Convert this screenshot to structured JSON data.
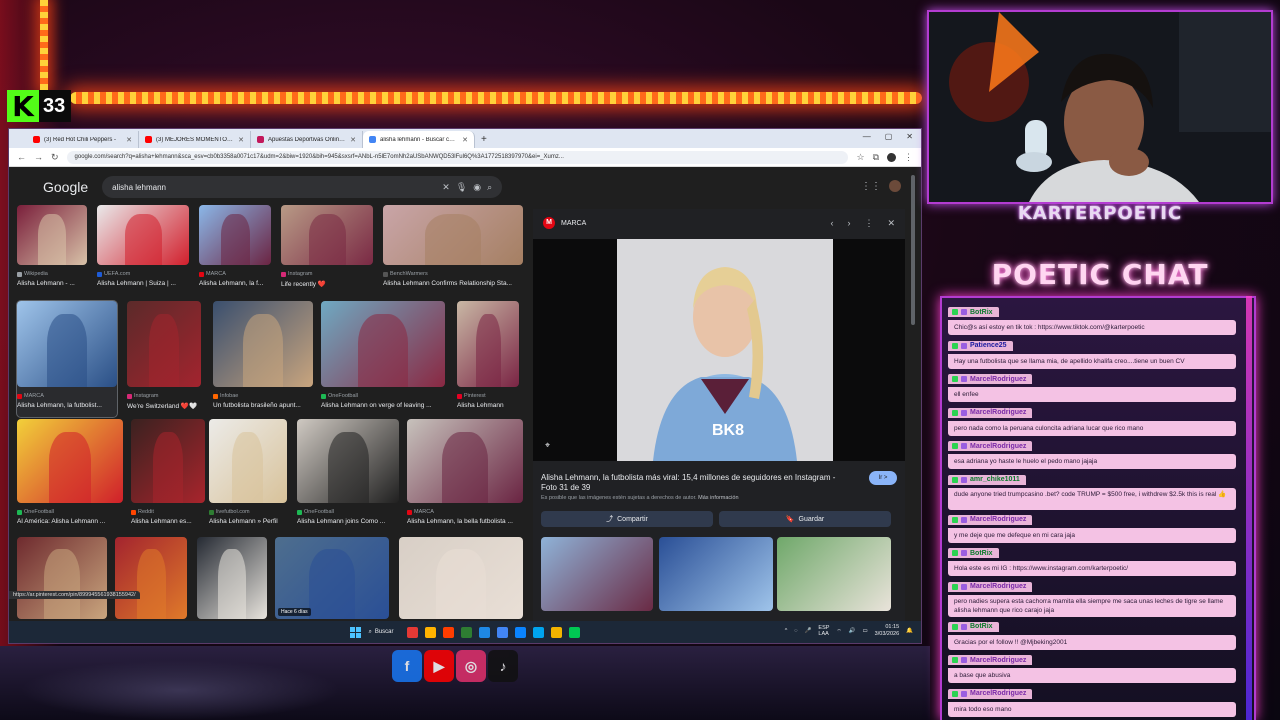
{
  "stream": {
    "kick_viewers": "33",
    "kick_logo_letter": "K",
    "streamer_name": "KARTERPOETIC",
    "chat_title": "POETIC CHAT"
  },
  "browser": {
    "tabs": [
      {
        "label": "(3) Red Hot Chili Peppers -",
        "color": "#ff0000"
      },
      {
        "label": "(3) MEJORES MOMENTOS KICK",
        "color": "#ff0000"
      },
      {
        "label": "Apuestas Deportivas Online | A",
        "color": "#c2185b"
      },
      {
        "label": "alisha lehmann - Buscar con G",
        "color": "#4285f4",
        "active": true
      }
    ],
    "url": "google.com/search?q=alisha+lehmann&sca_esv=cb0b3358a0071c17&udm=2&biw=1920&bih=945&sxsrf=ANbL-n5lE7omNh2aUSbANWQD53lFul6Q%3A1772518397970&ei=_Xumz...",
    "window_controls": [
      "—",
      "▢",
      "✕"
    ]
  },
  "google": {
    "logo": "Google",
    "query": "alisha lehmann",
    "results": [
      {
        "source": "Wikipedia",
        "title": "Alisha Lehmann - ...",
        "colors": [
          "#7a1f3b",
          "#d8c2a8"
        ],
        "src_color": "#9aa0a6"
      },
      {
        "source": "UEFA.com",
        "title": "Alisha Lehmann | Suiza | ...",
        "colors": [
          "#e9e9ea",
          "#d21f2c"
        ],
        "src_color": "#1e5bd6"
      },
      {
        "source": "MARCA",
        "title": "Alisha Lehmann, la f...",
        "colors": [
          "#8bb7e8",
          "#6b2442"
        ],
        "src_color": "#e30613"
      },
      {
        "source": "Instagram",
        "title": "Life recently ❤️",
        "colors": [
          "#b89a86",
          "#7a2944"
        ],
        "src_color": "#d62976"
      },
      {
        "source": "BenchWarmers",
        "title": "Alisha Lehmann Confirms Relationship Sta...",
        "colors": [
          "#c9a5a8",
          "#a57f62"
        ],
        "src_color": "#555555"
      },
      {
        "source": "MARCA",
        "title": "Alisha Lehmann, la futbolist...",
        "colors": [
          "#9fc4ea",
          "#2a4f86"
        ],
        "src_color": "#e30613",
        "selected": true
      },
      {
        "source": "Instagram",
        "title": "We're Switzerland ❤️🤍",
        "colors": [
          "#5b2a2a",
          "#a3242e"
        ],
        "src_color": "#d62976"
      },
      {
        "source": "Infobae",
        "title": "Un futbolista brasileño apunt...",
        "colors": [
          "#3a4f6e",
          "#c9a57e"
        ],
        "src_color": "#ff6600"
      },
      {
        "source": "OneFootball",
        "title": "Alisha Lehmann on verge of leaving ...",
        "colors": [
          "#6fa9c2",
          "#8a2842"
        ],
        "src_color": "#1db954"
      },
      {
        "source": "Pinterest",
        "title": "Alisha Lehmann",
        "colors": [
          "#c9b8a5",
          "#7a2444"
        ],
        "src_color": "#e60023"
      },
      {
        "source": "OneFootball",
        "title": "Al América: Alisha Lehmann ...",
        "colors": [
          "#f2d03a",
          "#d01f2a"
        ],
        "src_color": "#1db954"
      },
      {
        "source": "Reddit",
        "title": "Alisha Lehmann es...",
        "colors": [
          "#3a2220",
          "#a8242c"
        ],
        "src_color": "#ff4500"
      },
      {
        "source": "livefutbol.com",
        "title": "Alisha Lehmann » Perfil",
        "colors": [
          "#ecebe8",
          "#d8c29a"
        ],
        "src_color": "#2e7d32"
      },
      {
        "source": "OneFootball",
        "title": "Alisha Lehmann joins Como ...",
        "colors": [
          "#cfc9c2",
          "#202020"
        ],
        "src_color": "#1db954"
      },
      {
        "source": "MARCA",
        "title": "Alisha Lehmann, la bella futbolista ...",
        "colors": [
          "#c7c2bc",
          "#6a2442"
        ],
        "src_color": "#e30613"
      },
      {
        "source": "",
        "title": "",
        "colors": [
          "#6e2a2e",
          "#c9a57e"
        ],
        "src_color": "#555555"
      },
      {
        "source": "",
        "title": "",
        "colors": [
          "#a3242e",
          "#e07a2a"
        ],
        "src_color": "#555555"
      },
      {
        "source": "",
        "title": "",
        "colors": [
          "#252a33",
          "#e8e4dd"
        ],
        "src_color": "#555555"
      },
      {
        "source": "",
        "title": "",
        "colors": [
          "#4e6e8e",
          "#2a4f96"
        ],
        "src_color": "#555555",
        "badge": "Hace 6 días"
      },
      {
        "source": "",
        "title": "",
        "colors": [
          "#d8cfc6",
          "#e9dfd6"
        ],
        "src_color": "#555555"
      }
    ],
    "status_url": "https://ar.pinterest.com/pin/899945561938155942/"
  },
  "preview": {
    "source": "MARCA",
    "title": "Alisha Lehmann, la futbolista más viral: 15,4 millones de seguidores en Instagram - Foto 31 de 39",
    "copyright": "Es posible que las imágenes estén sujetas a derechos de autor.",
    "more_info": "Más información",
    "share_label": "Compartir",
    "save_label": "Guardar",
    "visit_label": "Ir >",
    "shirt_text": "BK8",
    "related_colors": [
      [
        "#8fb3d8",
        "#6a2a44"
      ],
      [
        "#2a4f96",
        "#9fc4ea"
      ],
      [
        "#6fa86a",
        "#e9e3da"
      ]
    ]
  },
  "taskbar": {
    "search_label": "Buscar",
    "lang": "ESP\nLAA",
    "time": "01:15",
    "date": "3/03/2026",
    "app_colors": [
      "#e53935",
      "#ffb300",
      "#ff3d00",
      "#2e7d32",
      "#1e88e5",
      "#4285f4",
      "#0a84ff",
      "#00a4ef",
      "#f4b400",
      "#00c853"
    ]
  },
  "chat": [
    {
      "user": "BotRix",
      "text": "Chic@s así estoy en tik tok : https://www.tiktok.com/@karterpoetic",
      "color": "#0a7a2a"
    },
    {
      "user": "Patience25",
      "text": "Hay una futbolista que se llama mia, de apellido khalifa creo....tiene un buen CV",
      "color": "#1a1aa0"
    },
    {
      "user": "MarcelRodriguez",
      "text": "ell enfee",
      "color": "#7a2aa8"
    },
    {
      "user": "MarcelRodriguez",
      "text": "pero nada como la peruana culoncita adriana lucar que rico mano",
      "color": "#7a2aa8"
    },
    {
      "user": "MarcelRodriguez",
      "text": "esa adriana yo haste le huelo el pedo mano jajaja",
      "color": "#7a2aa8"
    },
    {
      "user": "amr_chike1011",
      "text": "dude anyone tried trumpcasino .bet? code TRUMP = $500 free, i withdrew $2.5k this is real 👍",
      "color": "#0a7a2a",
      "tall": true
    },
    {
      "user": "MarcelRodriguez",
      "text": "y me deje que me defeque en mi cara jaja",
      "color": "#7a2aa8"
    },
    {
      "user": "BotRix",
      "text": "Hola este es mi IG : https://www.instagram.com/karterpoetic/",
      "color": "#0a7a2a"
    },
    {
      "user": "MarcelRodriguez",
      "text": "pero nadies supera esta cachorra mamita ella siempre me saca unas leches de tigre se llame alisha lehmann que rico carajo jaja",
      "color": "#7a2aa8",
      "tall": true
    },
    {
      "user": "BotRix",
      "text": "Gracias por el follow !! @Mjbeking2001",
      "color": "#0a7a2a"
    },
    {
      "user": "MarcelRodriguez",
      "text": "a base que abusiva",
      "color": "#7a2aa8"
    },
    {
      "user": "MarcelRodriguez",
      "text": "mira todo eso mano",
      "color": "#7a2aa8"
    }
  ],
  "socials": [
    {
      "name": "facebook-icon",
      "glyph": "f",
      "color": "#1877f2"
    },
    {
      "name": "youtube-icon",
      "glyph": "▶",
      "color": "#ff0000"
    },
    {
      "name": "instagram-icon",
      "glyph": "◎",
      "color": "#e1306c"
    },
    {
      "name": "tiktok-icon",
      "glyph": "♪",
      "color": "#111111"
    }
  ]
}
